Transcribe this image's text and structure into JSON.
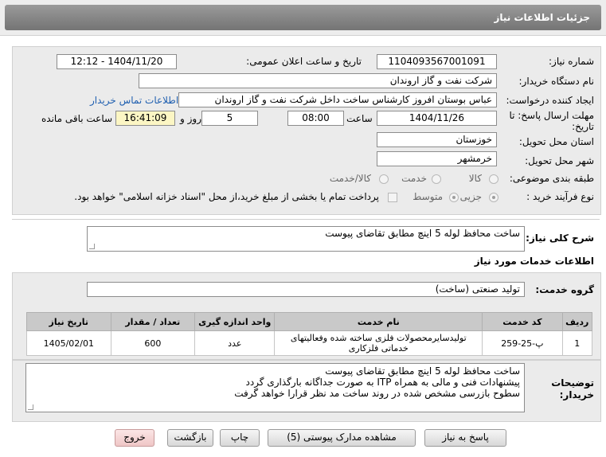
{
  "window": {
    "title": "جزئیات اطلاعات نیاز"
  },
  "form": {
    "need_number_label": "شماره نیاز:",
    "need_number": "1104093567001091",
    "announce_datetime_label": "تاریخ و ساعت اعلان عمومی:",
    "announce_datetime": "1404/11/20 - 12:12",
    "buyer_org_label": "نام دستگاه خریدار:",
    "buyer_org": "شرکت نفت و گاز اروندان",
    "requester_label": "ایجاد کننده درخواست:",
    "requester": "عباس بوستان افروز کارشناس ساخت داخل شرکت نفت و گاز اروندان",
    "buyer_contact_link": "اطلاعات تماس خریدار",
    "deadline_label_line1": "مهلت ارسال پاسخ: تا",
    "deadline_label_line2": "تاریخ:",
    "deadline_date": "1404/11/26",
    "time_label": "ساعت",
    "deadline_time": "08:00",
    "days_value": "5",
    "days_label": "روز و",
    "remaining_time": "16:41:09",
    "remaining_label": "ساعت باقی مانده",
    "province_label": "استان محل تحویل:",
    "province": "خوزستان",
    "city_label": "شهر محل تحویل:",
    "city": "خرمشهر",
    "category_label": "طبقه بندی موضوعی:",
    "category_options": [
      "کالا",
      "خدمت",
      "کالا/خدمت"
    ],
    "category_selected": "خدمت",
    "process_label": "نوع فرآیند خرید :",
    "process_options": [
      "جزیی",
      "متوسط"
    ],
    "process_selected": "جزیی",
    "treasury_note": "پرداخت تمام یا بخشی از مبلغ خرید،از محل \"اسناد خزانه اسلامی\" خواهد بود."
  },
  "summary": {
    "label": "شرح کلی نیاز:",
    "text": "ساخت محافظ لوله 5 اینچ مطابق تقاضای پیوست"
  },
  "services": {
    "section_title": "اطلاعات خدمات مورد نیاز",
    "group_label": "گروه خدمت:",
    "group_value": "تولید صنعتی (ساخت)",
    "table": {
      "headers": [
        "ردیف",
        "کد خدمت",
        "نام خدمت",
        "واحد اندازه گیری",
        "تعداد / مقدار",
        "تاریخ نیاز"
      ],
      "rows": [
        [
          "1",
          "پ-25-259",
          "تولیدسایرمحصولات فلزی ساخته شده وفعالیتهای خدماتی فلزکاری",
          "عدد",
          "600",
          "1405/02/01"
        ]
      ]
    }
  },
  "buyer_notes": {
    "label_line1": "توضیحات",
    "label_line2": "خریدار:",
    "lines": [
      "ساخت محافظ لوله 5 اینچ مطابق تقاضای پیوست",
      "پیشنهادات فنی و مالی به همراه ITP  به صورت جداگانه بارگذاری گردد",
      "سطوح بازرسی مشخص شده در روند ساخت مد نظر قرارا خواهد گرفت"
    ]
  },
  "buttons": {
    "reply": "پاسخ به نیاز",
    "attachments": "مشاهده مدارک پیوستی (5)",
    "print": "چاپ",
    "back": "بازگشت",
    "exit": "خروج"
  },
  "colors": {
    "title_bar": "#7f7f7f",
    "panel": "#ebebeb",
    "highlight": "#fcf6c4",
    "link": "#1f5fb0",
    "exit_button": "#f7d9d9"
  }
}
